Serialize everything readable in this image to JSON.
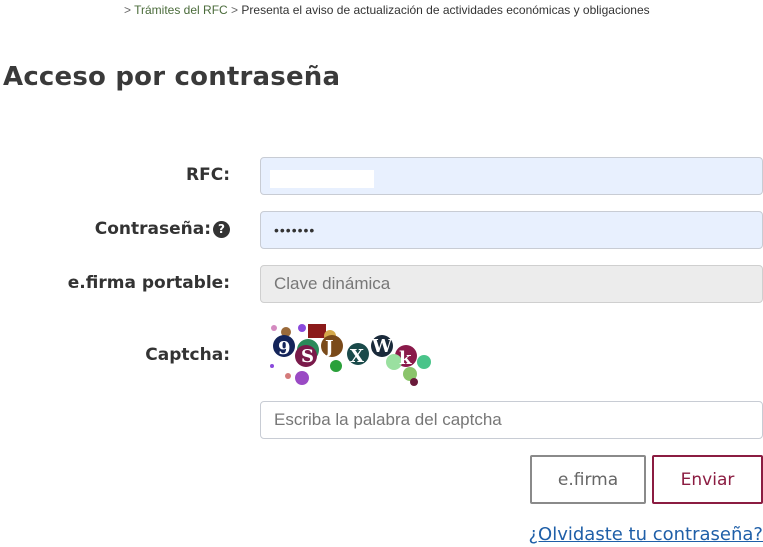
{
  "breadcrumb": {
    "prefix": "> ",
    "link": "Trámites del RFC",
    "separator": " > ",
    "current": "Presenta el aviso de actualización de actividades económicas y obligaciones"
  },
  "title": "Acceso por contraseña",
  "form": {
    "rfc_label": "RFC:",
    "rfc_value": "",
    "password_label": "Contraseña:",
    "password_value": "•••••••",
    "help_icon": "question-circle-icon",
    "efirma_label": "e.firma portable:",
    "efirma_placeholder": "Clave dinámica",
    "captcha_label": "Captcha:",
    "captcha_placeholder": "Escriba la palabra del captcha"
  },
  "buttons": {
    "efirma": "e.firma",
    "submit": "Enviar"
  },
  "forgot_link": "¿Olvidaste tu contraseña?",
  "colors": {
    "autofill": "#e8f0fe",
    "disabled": "#ececec",
    "submit_accent": "#8b1c41",
    "link": "#1f5fa8",
    "breadcrumb_link": "#4a6b3a"
  }
}
